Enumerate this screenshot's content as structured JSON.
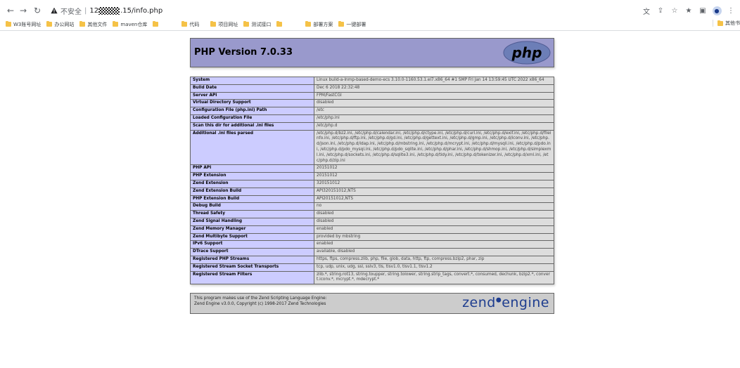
{
  "browser": {
    "address": {
      "insecure_label": "不安全",
      "host_prefix": "12",
      "host_suffix": ".15/info.php"
    },
    "bookmarks": [
      {
        "label": "W3账号网址"
      },
      {
        "label": "办公网站"
      },
      {
        "label": "其他文件"
      },
      {
        "label": "maven仓库"
      },
      {
        "label": ""
      },
      {
        "label": "代码"
      },
      {
        "label": "项目网址"
      },
      {
        "label": "测试接口"
      },
      {
        "label": ""
      },
      {
        "label": "部署方案"
      },
      {
        "label": "一键部署"
      }
    ],
    "bookmarks_other": "其他书"
  },
  "phpinfo": {
    "title": "PHP Version 7.0.33",
    "logo_text": "php",
    "rows": [
      {
        "key": "System",
        "value": "Linux build-a-lnmp-based-demo-ecs 3.10.0-1160.53.1.el7.x86_64 #1 SMP Fri Jan 14 13:59:45 UTC 2022 x86_64"
      },
      {
        "key": "Build Date",
        "value": "Dec 6 2018 22:32:48"
      },
      {
        "key": "Server API",
        "value": "FPM/FastCGI"
      },
      {
        "key": "Virtual Directory Support",
        "value": "disabled"
      },
      {
        "key": "Configuration File (php.ini) Path",
        "value": "/etc"
      },
      {
        "key": "Loaded Configuration File",
        "value": "/etc/php.ini"
      },
      {
        "key": "Scan this dir for additional .ini files",
        "value": "/etc/php.d"
      },
      {
        "key": "Additional .ini files parsed",
        "value": "/etc/php.d/bz2.ini, /etc/php.d/calendar.ini, /etc/php.d/ctype.ini, /etc/php.d/curl.ini, /etc/php.d/exif.ini, /etc/php.d/fileinfo.ini, /etc/php.d/ftp.ini, /etc/php.d/gd.ini, /etc/php.d/gettext.ini, /etc/php.d/gmp.ini, /etc/php.d/iconv.ini, /etc/php.d/json.ini, /etc/php.d/ldap.ini, /etc/php.d/mbstring.ini, /etc/php.d/mcrypt.ini, /etc/php.d/mysqli.ini, /etc/php.d/pdo.ini, /etc/php.d/pdo_mysql.ini, /etc/php.d/pdo_sqlite.ini, /etc/php.d/phar.ini, /etc/php.d/shmop.ini, /etc/php.d/simplexml.ini, /etc/php.d/sockets.ini, /etc/php.d/sqlite3.ini, /etc/php.d/tidy.ini, /etc/php.d/tokenizer.ini, /etc/php.d/xml.ini, /etc/php.d/zip.ini"
      },
      {
        "key": "PHP API",
        "value": "20151012"
      },
      {
        "key": "PHP Extension",
        "value": "20151012"
      },
      {
        "key": "Zend Extension",
        "value": "320151012"
      },
      {
        "key": "Zend Extension Build",
        "value": "API320151012,NTS"
      },
      {
        "key": "PHP Extension Build",
        "value": "API20151012,NTS"
      },
      {
        "key": "Debug Build",
        "value": "no"
      },
      {
        "key": "Thread Safety",
        "value": "disabled"
      },
      {
        "key": "Zend Signal Handling",
        "value": "disabled"
      },
      {
        "key": "Zend Memory Manager",
        "value": "enabled"
      },
      {
        "key": "Zend Multibyte Support",
        "value": "provided by mbstring"
      },
      {
        "key": "IPv6 Support",
        "value": "enabled"
      },
      {
        "key": "DTrace Support",
        "value": "available, disabled"
      },
      {
        "key": "Registered PHP Streams",
        "value": "https, ftps, compress.zlib, php, file, glob, data, http, ftp, compress.bzip2, phar, zip"
      },
      {
        "key": "Registered Stream Socket Transports",
        "value": "tcp, udp, unix, udg, ssl, sslv3, tls, tlsv1.0, tlsv1.1, tlsv1.2"
      },
      {
        "key": "Registered Stream Filters",
        "value": "zlib.*, string.rot13, string.toupper, string.tolower, string.strip_tags, convert.*, consumed, dechunk, bzip2.*, convert.iconv.*, mcrypt.*, mdecrypt.*"
      }
    ],
    "zend": {
      "line1": "This program makes use of the Zend Scripting Language Engine:",
      "line2": "Zend Engine v3.0.0, Copyright (c) 1998-2017 Zend Technologies",
      "logo_word_1": "zend",
      "logo_word_2": "engine"
    }
  },
  "colors": {
    "header_bg": "#9999cc",
    "key_cell_bg": "#ccccff",
    "value_cell_bg": "#dddddd",
    "zend_box_bg": "#cccccc",
    "border": "#666666",
    "bookmark_folder": "#f5c247"
  },
  "icons": [
    "back-icon",
    "forward-icon",
    "reload-icon",
    "warning-icon",
    "translate-icon",
    "share-icon",
    "star-icon",
    "extensions-icon",
    "sidepanel-icon",
    "profile-avatar",
    "folder-icon",
    "php-logo",
    "zend-engine-logo"
  ]
}
